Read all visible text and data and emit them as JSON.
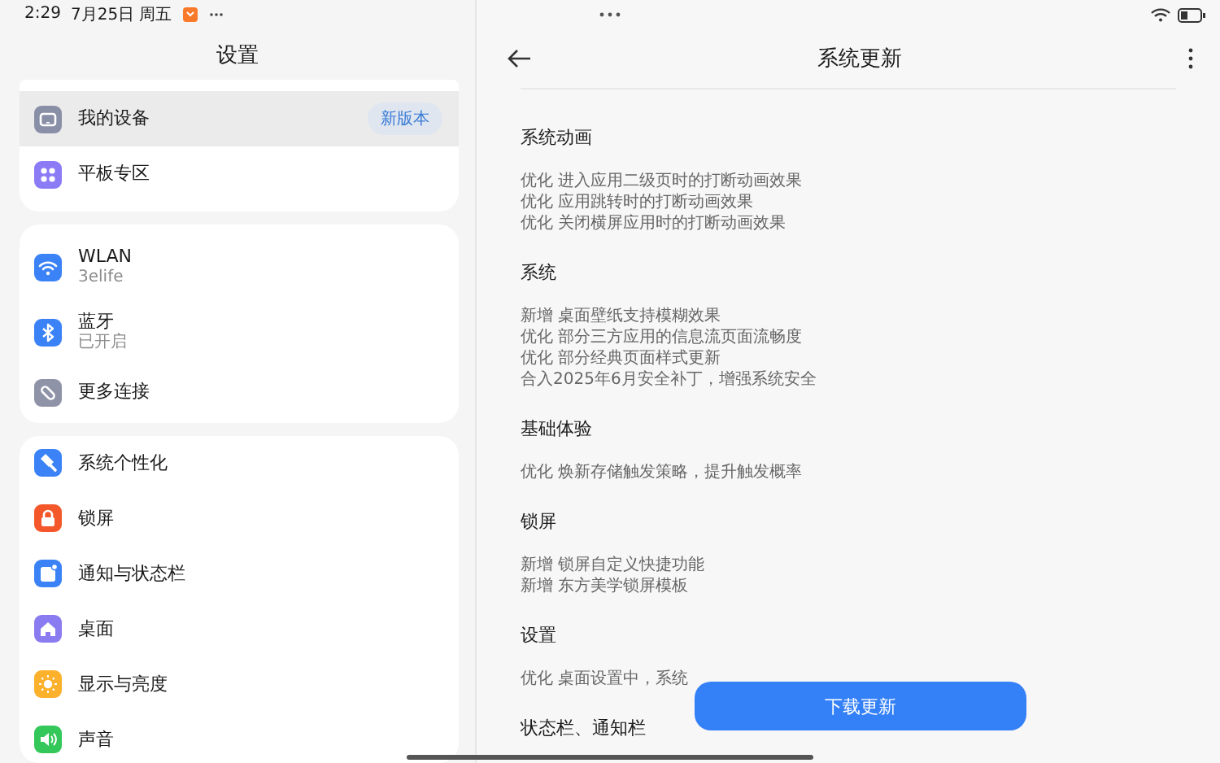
{
  "status_bar": {
    "time": "2:29",
    "date": "7月25日 周五"
  },
  "sidebar": {
    "title": "设置",
    "groups": [
      {
        "items": [
          {
            "label": "我的设备",
            "badge": "新版本",
            "selected": true
          },
          {
            "label": "平板专区",
            "selected": false
          }
        ]
      },
      {
        "items": [
          {
            "label": "WLAN",
            "subtitle": "3elife",
            "selected": false
          },
          {
            "label": "蓝牙",
            "subtitle": "已开启",
            "selected": false
          },
          {
            "label": "更多连接",
            "selected": false
          }
        ]
      },
      {
        "items": [
          {
            "label": "系统个性化",
            "selected": false
          },
          {
            "label": "锁屏",
            "selected": false
          },
          {
            "label": "通知与状态栏",
            "selected": false
          },
          {
            "label": "桌面",
            "selected": false
          },
          {
            "label": "显示与亮度",
            "selected": false
          },
          {
            "label": "声音",
            "selected": false
          }
        ]
      }
    ]
  },
  "detail": {
    "title": "系统更新",
    "sections": [
      {
        "heading": "系统动画",
        "lines": [
          "优化 进入应用二级页时的打断动画效果",
          "优化 应用跳转时的打断动画效果",
          "优化 关闭横屏应用时的打断动画效果"
        ]
      },
      {
        "heading": "系统",
        "lines": [
          "新增 桌面壁纸支持模糊效果",
          "优化 部分三方应用的信息流页面流畅度",
          "优化 部分经典页面样式更新",
          "合入2025年6月安全补丁，增强系统安全"
        ]
      },
      {
        "heading": "基础体验",
        "lines": [
          "优化 焕新存储触发策略，提升触发概率"
        ]
      },
      {
        "heading": "锁屏",
        "lines": [
          "新增 锁屏自定义快捷功能",
          "新增 东方美学锁屏模板"
        ]
      },
      {
        "heading": "设置",
        "lines": [
          "优化 桌面设置中，系统"
        ]
      },
      {
        "heading": "状态栏、通知栏"
      }
    ],
    "download_button": "下载更新"
  }
}
